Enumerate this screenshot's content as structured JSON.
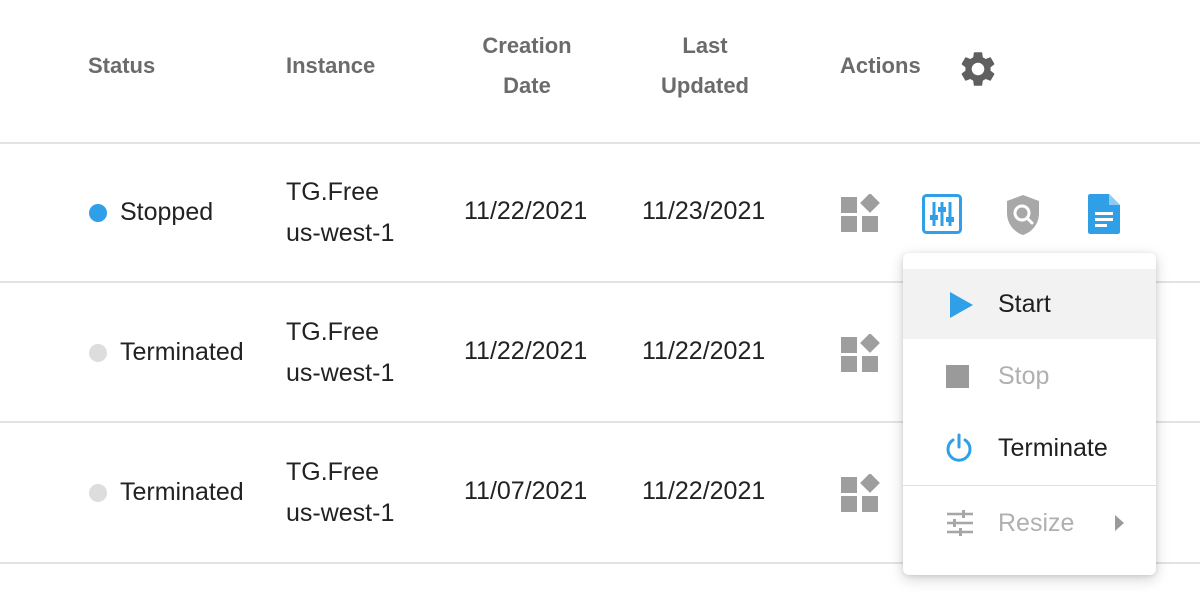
{
  "columns": {
    "status": "Status",
    "instance": "Instance",
    "creation_line1": "Creation",
    "creation_line2": "Date",
    "updated_line1": "Last",
    "updated_line2": "Updated",
    "actions": "Actions",
    "settings_icon": "gear-icon"
  },
  "rows": [
    {
      "status": "Stopped",
      "status_color": "#2f9fe8",
      "instance_line1": "TG.Free",
      "instance_line2": "us-west-1",
      "created": "11/22/2021",
      "updated": "11/23/2021"
    },
    {
      "status": "Terminated",
      "status_color": "#dddddd",
      "instance_line1": "TG.Free",
      "instance_line2": "us-west-1",
      "created": "11/22/2021",
      "updated": "11/22/2021"
    },
    {
      "status": "Terminated",
      "status_color": "#dddddd",
      "instance_line1": "TG.Free",
      "instance_line2": "us-west-1",
      "created": "11/07/2021",
      "updated": "11/22/2021"
    }
  ],
  "row_action_icons": [
    "apps-icon",
    "tune-icon",
    "shield-search-icon",
    "document-icon"
  ],
  "menu": {
    "items": [
      {
        "label": "Start",
        "icon": "play-icon",
        "enabled": true
      },
      {
        "label": "Stop",
        "icon": "stop-icon",
        "enabled": false
      },
      {
        "label": "Terminate",
        "icon": "power-icon",
        "enabled": true
      },
      {
        "label": "Resize",
        "icon": "sliders-icon",
        "enabled": false,
        "has_submenu": true
      }
    ]
  },
  "colors": {
    "accent": "#2f9fe8",
    "header_text": "#6b6b6b",
    "icon_gray": "#9e9e9e",
    "disabled_text": "#b0b0b0"
  }
}
